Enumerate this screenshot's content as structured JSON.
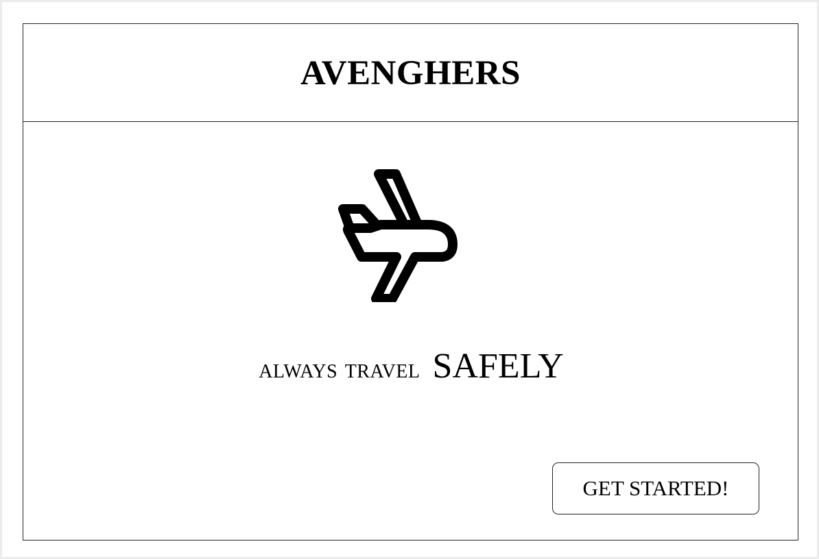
{
  "header": {
    "brand": "AVENGHERS"
  },
  "hero": {
    "icon": "airplane-icon",
    "tagline_small": "always travel",
    "tagline_big": "SAFELY"
  },
  "cta": {
    "label": "GET STARTED!"
  }
}
